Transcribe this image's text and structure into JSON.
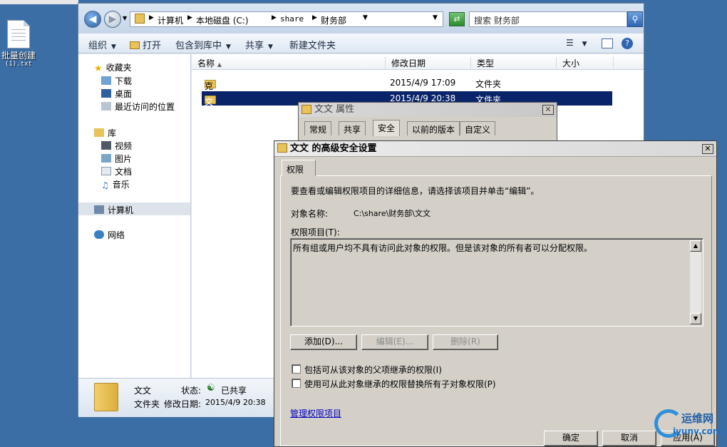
{
  "desktop": {
    "icon_name": "批量创建",
    "icon_ext": "(1).txt"
  },
  "explorer": {
    "breadcrumb": [
      "计算机",
      "本地磁盘 (C:)",
      "share",
      "财务部"
    ],
    "search_placeholder": "搜索 财务部",
    "toolbar": [
      "组织",
      "打开",
      "包含到库中",
      "共享",
      "新建文件夹"
    ],
    "nav": {
      "favorites": "收藏夹",
      "fav_items": [
        "下载",
        "桌面",
        "最近访问的位置"
      ],
      "libraries": "库",
      "lib_items": [
        "视频",
        "图片",
        "文档",
        "音乐"
      ],
      "computer": "计算机",
      "network": "网络"
    },
    "columns": [
      "名称",
      "修改日期",
      "类型",
      "大小"
    ],
    "rows": [
      {
        "name": "克克",
        "date": "2015/4/9 17:09",
        "type": "文件夹"
      },
      {
        "name": "文文",
        "date": "2015/4/9 20:38",
        "type": "文件夹"
      }
    ],
    "details": {
      "name": "文文",
      "type": "文件夹",
      "state_label": "状态:",
      "state_value": "已共享",
      "date_label": "修改日期:",
      "date_value": "2015/4/9 20:38"
    }
  },
  "props": {
    "title": "文文 属性",
    "tabs": [
      "常规",
      "共享",
      "安全",
      "以前的版本",
      "自定义"
    ]
  },
  "adv": {
    "title": "文文 的高级安全设置",
    "tab": "权限",
    "intro": "要查看或编辑权限项目的详细信息，请选择该项目并单击“编辑”。",
    "object_label": "对象名称:",
    "object_value": "C:\\share\\财务部\\文文",
    "entries_label": "权限项目(T):",
    "entries_msg": "所有组或用户均不具有访问此对象的权限。但是该对象的所有者可以分配权限。",
    "buttons": {
      "add": "添加(D)...",
      "edit": "编辑(E)...",
      "remove": "删除(R)"
    },
    "check1": "包括可从该对象的父项继承的权限(I)",
    "check2": "使用可从此对象继承的权限替换所有子对象权限(P)",
    "link": "管理权限项目",
    "ok": "确定",
    "cancel": "取消",
    "apply": "应用(A)"
  },
  "watermark": {
    "line1": "运维网",
    "line2": "iyunv.com"
  }
}
